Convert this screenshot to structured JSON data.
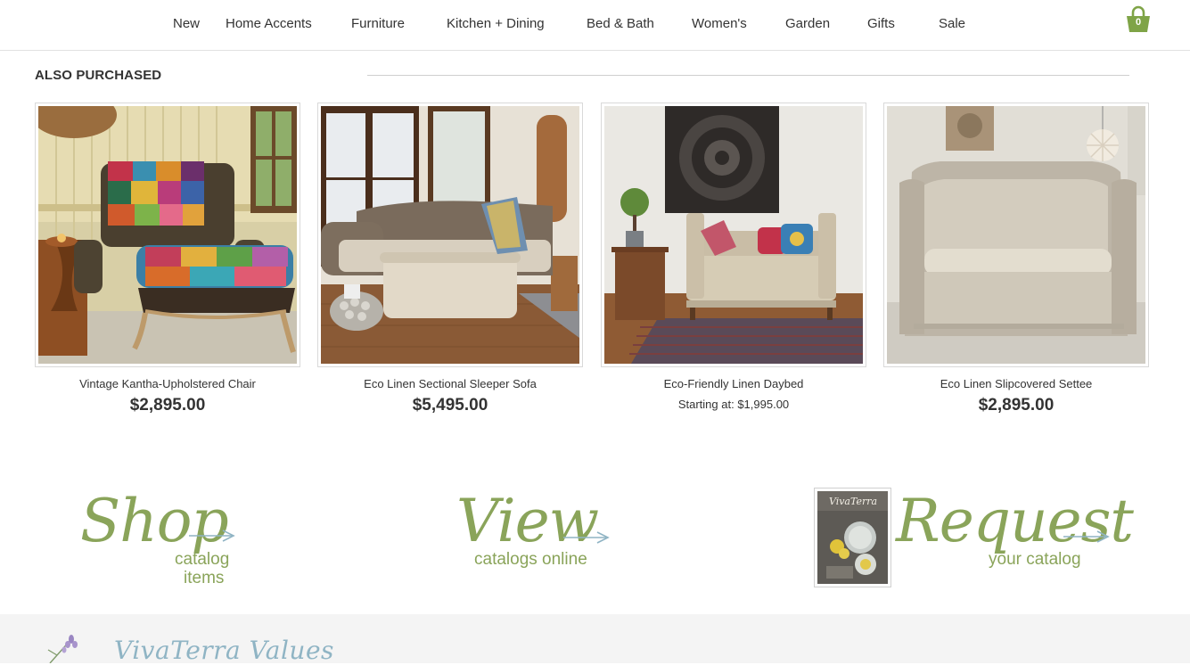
{
  "nav": {
    "items": [
      "New",
      "Home Accents",
      "Furniture",
      "Kitchen + Dining",
      "Bed & Bath",
      "Women's",
      "Garden",
      "Gifts",
      "Sale"
    ],
    "cart_count": "0",
    "cart_icon": "shopping-bag-icon",
    "accent_color": "#7fa447"
  },
  "also_purchased": {
    "title": "ALSO PURCHASED",
    "products": [
      {
        "name": "Vintage Kantha-Upholstered Chair",
        "price": "$2,895.00"
      },
      {
        "name": "Eco Linen Sectional Sleeper Sofa",
        "price": "$5,495.00"
      },
      {
        "name": "Eco-Friendly Linen Daybed",
        "price_prefix": "Starting at:",
        "price": "$1,995.00"
      },
      {
        "name": "Eco Linen Slipcovered Settee",
        "price": "$2,895.00"
      }
    ]
  },
  "promos": {
    "shop": {
      "script": "Shop",
      "sub1": "catalog",
      "sub2": "items"
    },
    "view": {
      "script": "View",
      "sub": "catalogs online"
    },
    "request": {
      "script": "Request",
      "sub": "your catalog",
      "cover_title": "VivaTerra"
    }
  },
  "footer": {
    "values_title": "VivaTerra Values"
  }
}
